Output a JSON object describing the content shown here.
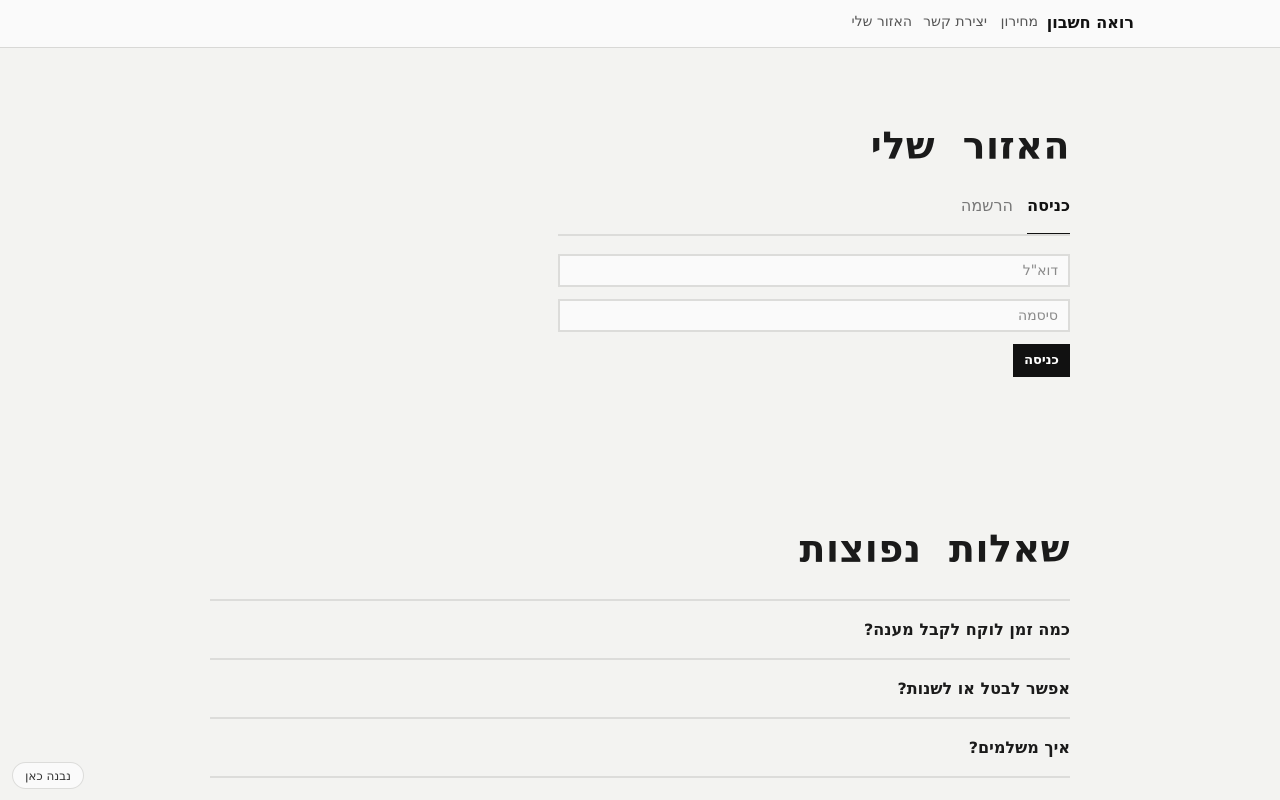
{
  "header": {
    "brand": "רואה חשבון",
    "nav": {
      "pricing": "מחירון",
      "contact": "יצירת קשר",
      "my_area": "האזור שלי"
    }
  },
  "account": {
    "title": "האזור  שלי",
    "tabs": {
      "login": "כניסה",
      "register": "הרשמה"
    },
    "email_placeholder": "דוא\"ל",
    "password_placeholder": "סיסמה",
    "submit_label": "כניסה"
  },
  "faq": {
    "title": "שאלות  נפוצות",
    "items": [
      {
        "question": "כמה זמן לוקח לקבל מענה?"
      },
      {
        "question": "אפשר לבטל או לשנות?"
      },
      {
        "question": "איך משלמים?"
      }
    ]
  },
  "badge": {
    "label": "נבנה כאן"
  }
}
